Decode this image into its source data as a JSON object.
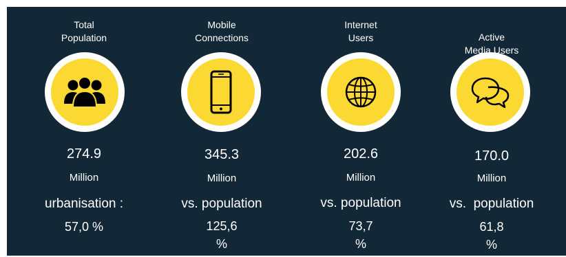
{
  "accent_color": "#fcd932",
  "background_color": "#132837",
  "stats": [
    {
      "title": "Total\nPopulation",
      "icon": "people-group-icon",
      "value": "274.9",
      "unit": "Million",
      "label": "urbanisation :",
      "stat_line1": "57,0 %",
      "stat_line2": ""
    },
    {
      "title": "Mobile\nConnections",
      "icon": "mobile-phone-icon",
      "value": "345.3",
      "unit": "Million",
      "label": "vs. population",
      "stat_line1": "125,6",
      "stat_line2": "%"
    },
    {
      "title": "Internet\nUsers",
      "icon": "globe-icon",
      "value": "202.6",
      "unit": "Million",
      "label": "vs. population",
      "stat_line1": "73,7",
      "stat_line2": "%"
    },
    {
      "title": "Active\nMedia Users",
      "icon": "chat-bubbles-icon",
      "value": "170.0",
      "unit": "Million",
      "label": "vs.  population",
      "stat_line1": "61,8",
      "stat_line2": "%"
    }
  ]
}
